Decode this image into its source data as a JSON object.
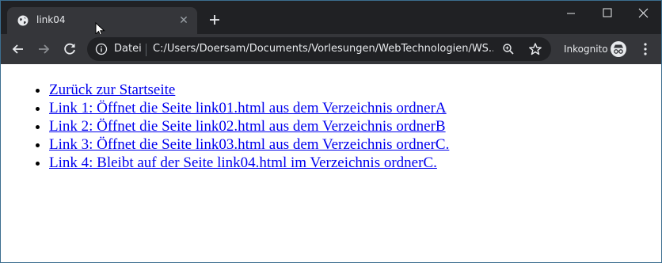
{
  "tab": {
    "title": "link04"
  },
  "address": {
    "scheme_label": "Datei",
    "url": "C:/Users/Doersam/Documents/Vorlesungen/WebTechnologien/WS..."
  },
  "profile": {
    "label": "Inkognito"
  },
  "icons": {
    "favicon": "globe-icon",
    "close": "close-icon",
    "new_tab": "plus-icon",
    "back": "arrow-left-icon",
    "forward": "arrow-right-icon",
    "reload": "reload-icon",
    "info": "info-icon",
    "zoom": "zoom-icon",
    "bookmark": "star-icon",
    "incognito": "incognito-icon",
    "menu": "kebab-menu-icon"
  },
  "colors": {
    "link": "#0000ee",
    "chrome_dark": "#202124",
    "toolbar": "#35363a"
  },
  "page": {
    "links": [
      {
        "label": "Zurück zur Startseite"
      },
      {
        "label": "Link 1: Öffnet die Seite link01.html aus dem Verzeichnis ordnerA"
      },
      {
        "label": "Link 2: Öffnet die Seite link02.html aus dem Verzeichnis ordnerB"
      },
      {
        "label": "Link 3: Öffnet die Seite link03.html aus dem Verzeichnis ordnerC."
      },
      {
        "label": "Link 4: Bleibt auf der Seite link04.html im Verzeichnis ordnerC."
      }
    ]
  }
}
